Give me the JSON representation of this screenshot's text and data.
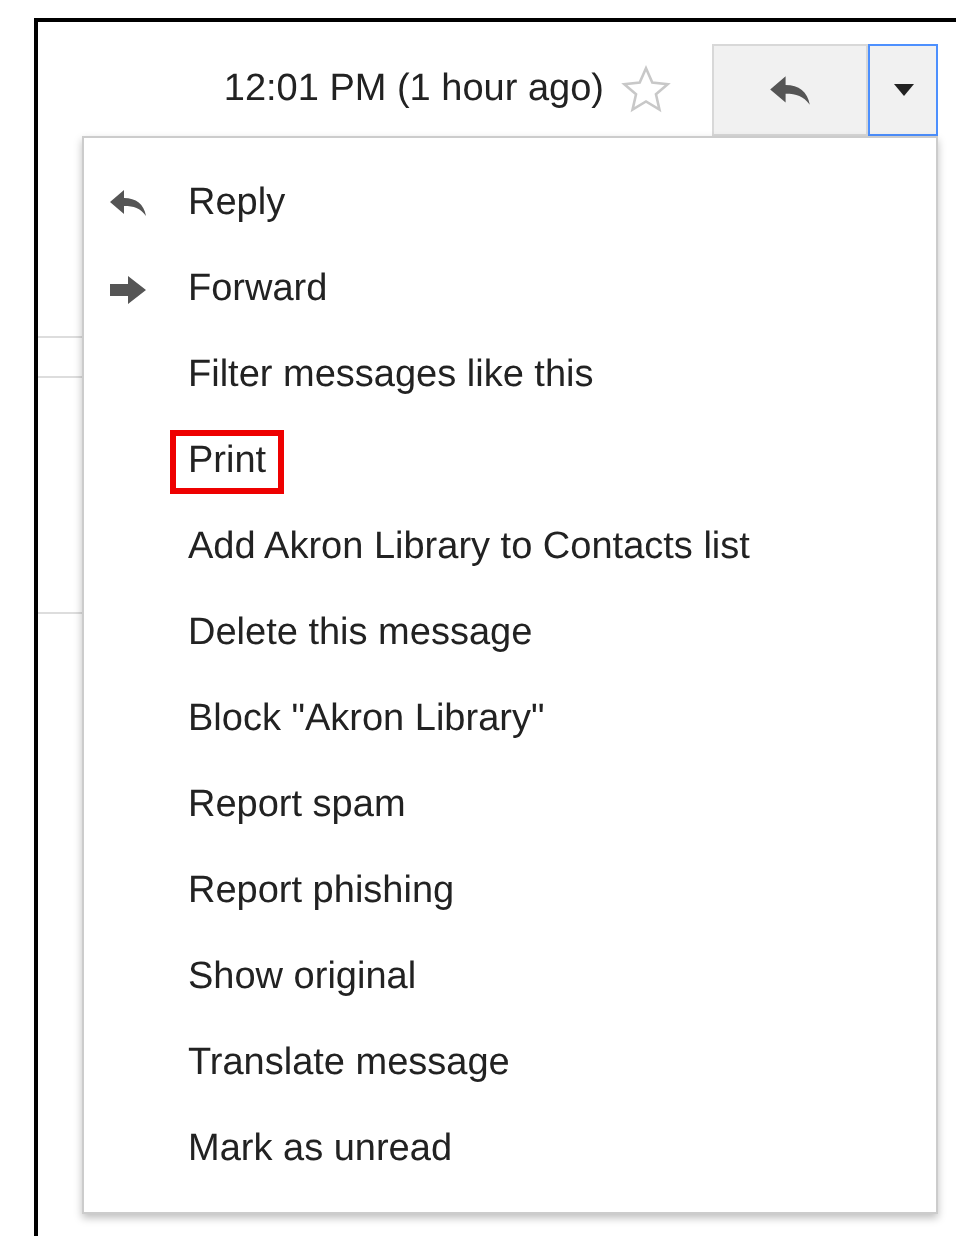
{
  "header": {
    "timestamp": "12:01 PM (1 hour ago)",
    "starred": false
  },
  "menu": {
    "items": [
      {
        "label": "Reply",
        "kind": "reply",
        "highlighted": false
      },
      {
        "label": "Forward",
        "kind": "forward",
        "highlighted": false
      },
      {
        "label": "Filter messages like this",
        "kind": "plain",
        "highlighted": false
      },
      {
        "label": "Print",
        "kind": "plain",
        "highlighted": true
      },
      {
        "label": "Add Akron Library to Contacts list",
        "kind": "plain",
        "highlighted": false
      },
      {
        "label": "Delete this message",
        "kind": "plain",
        "highlighted": false
      },
      {
        "label": "Block \"Akron Library\"",
        "kind": "plain",
        "highlighted": false
      },
      {
        "label": "Report spam",
        "kind": "plain",
        "highlighted": false
      },
      {
        "label": "Report phishing",
        "kind": "plain",
        "highlighted": false
      },
      {
        "label": "Show original",
        "kind": "plain",
        "highlighted": false
      },
      {
        "label": "Translate message",
        "kind": "plain",
        "highlighted": false
      },
      {
        "label": "Mark as unread",
        "kind": "plain",
        "highlighted": false
      }
    ]
  }
}
